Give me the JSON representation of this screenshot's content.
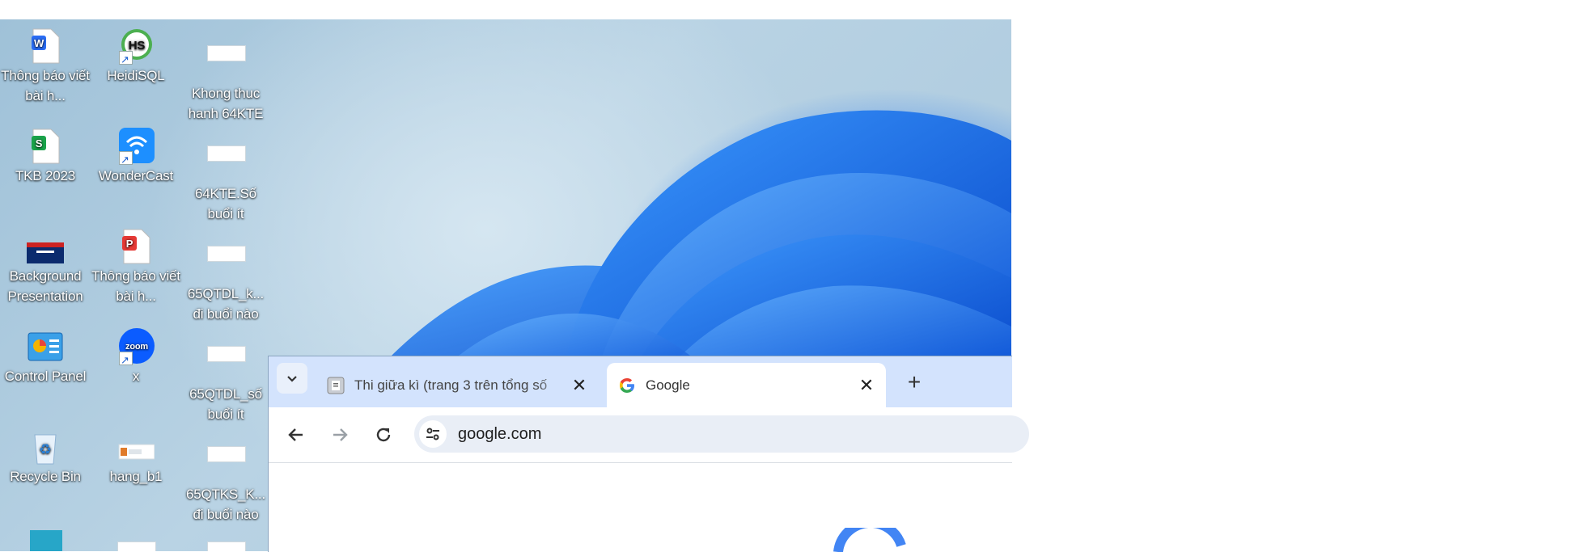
{
  "desktop": {
    "icons": [
      {
        "label": "Thông báo viết bài h...",
        "icon": "wps-writer-doc-icon"
      },
      {
        "label": "HeidiSQL",
        "icon": "heidisql-icon"
      },
      {
        "label": "Khong thuc hanh 64KTE",
        "icon": "file-thumbnail-icon"
      },
      {
        "label": "TKB 2023",
        "icon": "wps-spreadsheet-icon"
      },
      {
        "label": "WonderCast",
        "icon": "wondercast-icon"
      },
      {
        "label": "64KTE.Số buổi ít",
        "icon": "file-thumbnail-icon"
      },
      {
        "label": "Background Presentation",
        "icon": "presentation-thumbnail-icon"
      },
      {
        "label": "Thông báo viết bài h...",
        "icon": "wps-pdf-icon"
      },
      {
        "label": "65QTDL_k... đi buổi nào",
        "icon": "file-thumbnail-icon"
      },
      {
        "label": "Control Panel",
        "icon": "control-panel-icon"
      },
      {
        "label": "x",
        "icon": "zoom-icon"
      },
      {
        "label": "65QTDL_số buổi ít",
        "icon": "file-thumbnail-icon"
      },
      {
        "label": "Recycle Bin",
        "icon": "recycle-bin-icon"
      },
      {
        "label": "hang_b1",
        "icon": "file-thumbnail-icon"
      },
      {
        "label": "65QTKS_K... đi buổi nào",
        "icon": "file-thumbnail-icon"
      }
    ]
  },
  "browser": {
    "tabs": [
      {
        "title": "Thi giữa kì (trang 3 trên tổng số",
        "icon": "document-favicon-icon",
        "active": false
      },
      {
        "title": "Google",
        "icon": "google-favicon-icon",
        "active": true
      }
    ],
    "url": "google.com"
  },
  "colors": {
    "tabstrip": "#d3e3fd",
    "omnibox": "#e9eef6",
    "wallpaper_blue": "#1a6ff0"
  }
}
